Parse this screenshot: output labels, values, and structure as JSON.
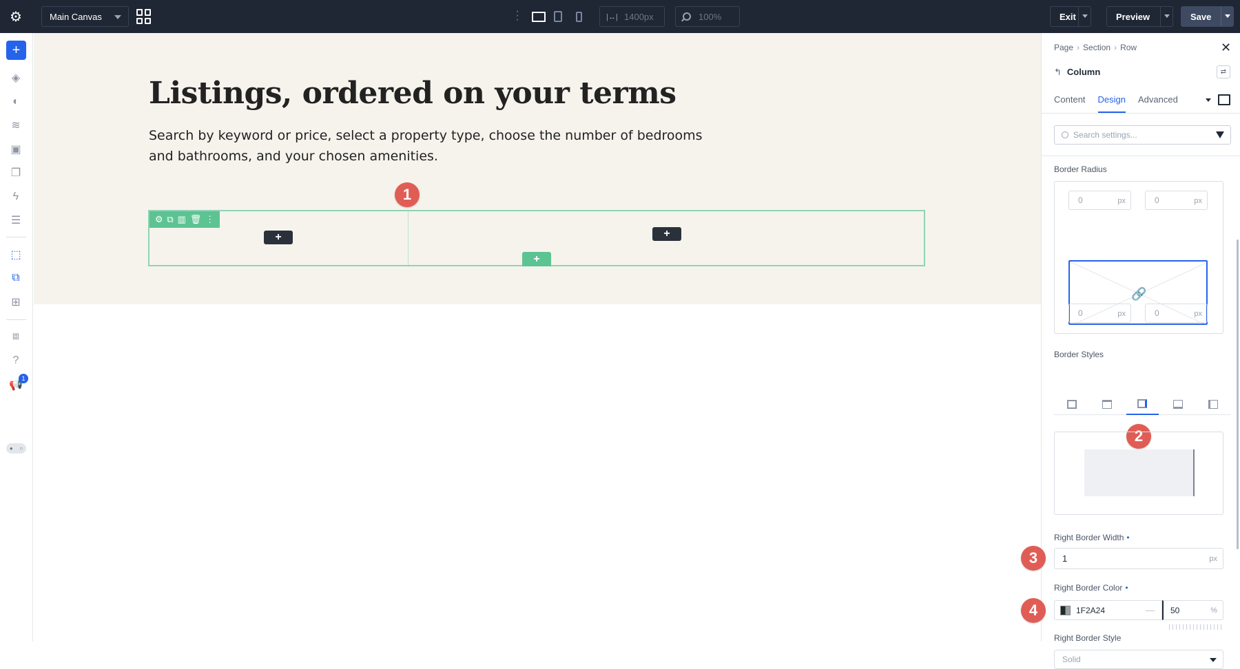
{
  "topbar": {
    "canvas_select": "Main Canvas",
    "width_value": "1400px",
    "zoom_value": "100%",
    "exit_label": "Exit",
    "preview_label": "Preview",
    "save_label": "Save"
  },
  "leftbar": {
    "add_label": "+",
    "notification_count": "1",
    "help_label": "?"
  },
  "canvas": {
    "title": "Listings, ordered on your terms",
    "subtitle": "Search by keyword or price, select a property type, choose the number of bedrooms and bathrooms, and your chosen amenities.",
    "add_label": "+"
  },
  "markers": [
    "1",
    "2",
    "3",
    "4"
  ],
  "panel": {
    "breadcrumbs": [
      "Page",
      "Section",
      "Row"
    ],
    "element_title": "Column",
    "tabs": [
      {
        "label": "Content",
        "active": false
      },
      {
        "label": "Design",
        "active": true
      },
      {
        "label": "Advanced",
        "active": false
      }
    ],
    "search_placeholder": "Search settings...",
    "border_radius": {
      "label": "Border Radius",
      "top_left": "0",
      "top_right": "0",
      "bottom_left": "0",
      "bottom_right": "0",
      "unit": "px"
    },
    "border_styles": {
      "label": "Border Styles",
      "options": [
        "all",
        "top",
        "right",
        "bottom",
        "left"
      ],
      "active": "right"
    },
    "right_border_width": {
      "label": "Right Border Width",
      "value": "1",
      "unit": "px"
    },
    "right_border_color": {
      "label": "Right Border Color",
      "hex": "1F2A24",
      "opacity": "50",
      "unit": "%"
    },
    "right_border_style": {
      "label": "Right Border Style",
      "value": "Solid"
    }
  },
  "colors": {
    "accent": "#2563eb",
    "topbar_bg": "#1f2634",
    "row_outline": "#8fd3b3",
    "row_tools": "#5cc392",
    "marker": "#e05d55",
    "hero_bg": "#f6f3ed"
  }
}
